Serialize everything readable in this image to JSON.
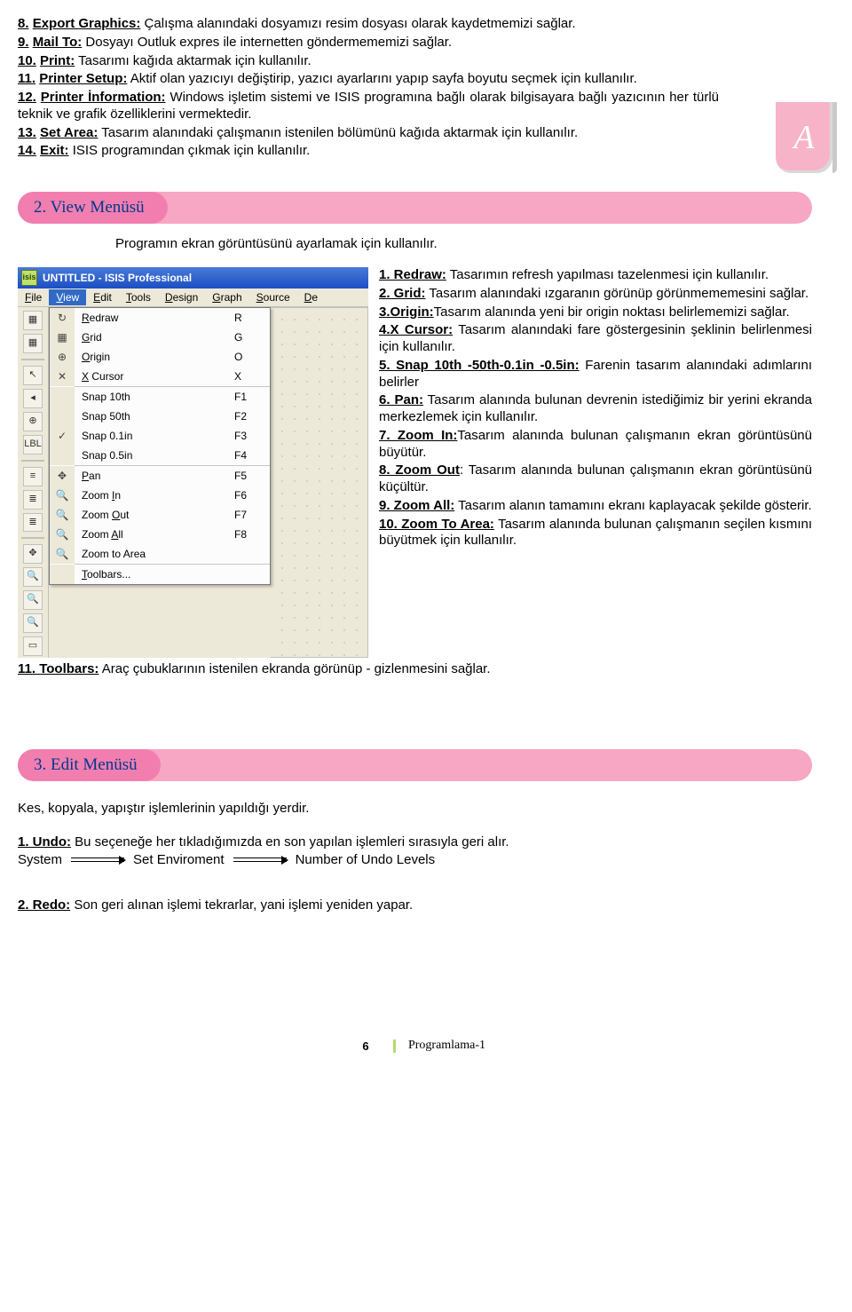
{
  "side_tab": "A",
  "pink1_label": "2. View Menüsü",
  "pink2_label": "3. Edit Menüsü",
  "top_items": [
    {
      "num": "8.",
      "title": "Export Graphics:",
      "text": " Çalışma alanındaki dosyamızı resim dosyası olarak kaydetmemizi sağlar."
    },
    {
      "num": "9.",
      "title": "Mail To:",
      "text": " Dosyayı  Outluk expres ile internetten göndermememizi sağlar."
    },
    {
      "num": "10.",
      "title": "Print:",
      "text": " Tasarımı kağıda aktarmak için kullanılır."
    },
    {
      "num": "11.",
      "title": "Printer Setup:",
      "text": " Aktif olan yazıcıyı değiştirip,  yazıcı ayarlarını yapıp sayfa boyutu seçmek için kullanılır."
    },
    {
      "num": "12.",
      "title": "Printer İnformation:",
      "text": " Windows işletim sistemi ve ISIS programına bağlı olarak bilgisayara bağlı yazıcının her türlü teknik ve grafik özelliklerini vermektedir."
    },
    {
      "num": "13.",
      "title": "Set Area:",
      "text": " Tasarım alanındaki çalışmanın istenilen bölümünü kağıda aktarmak için kullanılır."
    },
    {
      "num": "14.",
      "title": "Exit:",
      "text": "  ISIS programından çıkmak için kullanılır."
    }
  ],
  "view_intro": "Programın ekran görüntüsünü ayarlamak için kullanılır.",
  "titlebar": "UNTITLED - ISIS Professional",
  "menubar": [
    "File",
    "View",
    "Edit",
    "Tools",
    "Design",
    "Graph",
    "Source",
    "De"
  ],
  "menubar_active_index": 1,
  "menu_items": [
    {
      "icon": "↻",
      "label": "Redraw",
      "ul": "R",
      "key": "R"
    },
    {
      "icon": "▦",
      "label": "Grid",
      "ul": "G",
      "key": "G"
    },
    {
      "icon": "⊕",
      "label": "Origin",
      "ul": "O",
      "key": "O"
    },
    {
      "icon": "✕",
      "label": "X Cursor",
      "ul": "X",
      "key": "X"
    },
    {
      "sep": true
    },
    {
      "icon": "",
      "label": "Snap 10th",
      "key": "F1"
    },
    {
      "icon": "",
      "label": "Snap 50th",
      "key": "F2"
    },
    {
      "icon": "✓",
      "label": "Snap 0.1in",
      "key": "F3"
    },
    {
      "icon": "",
      "label": "Snap 0.5in",
      "key": "F4"
    },
    {
      "sep": true
    },
    {
      "icon": "✥",
      "label": "Pan",
      "ul": "P",
      "key": "F5"
    },
    {
      "icon": "🔍",
      "label": "Zoom In",
      "ul": "I",
      "key": "F6"
    },
    {
      "icon": "🔍",
      "label": "Zoom Out",
      "ul": "O",
      "key": "F7"
    },
    {
      "icon": "🔍",
      "label": "Zoom All",
      "ul": "A",
      "key": "F8"
    },
    {
      "icon": "🔍",
      "label": "Zoom to Area",
      "key": ""
    },
    {
      "sep": true
    },
    {
      "icon": "",
      "label": "Toolbars...",
      "ul": "T",
      "key": ""
    }
  ],
  "left_tools": [
    "▦",
    "▦",
    "↖",
    "◂",
    "⊕",
    "LBL",
    "≡",
    "≣",
    "≣",
    "✥",
    "🔍",
    "🔍",
    "🔍",
    "▭"
  ],
  "right_items": [
    {
      "title": "1. Redraw:",
      "text": " Tasarımın refresh yapılması tazelenmesi için kullanılır."
    },
    {
      "title": "2. Grid:",
      "text": " Tasarım alanındaki ızgaranın görünüp görünmememesini sağlar."
    },
    {
      "title": "3.Origin:",
      "text": "Tasarım alanında yeni bir origin noktası belirlememizi sağlar."
    },
    {
      "title": "4.X Cursor:",
      "text": " Tasarım alanındaki fare göstergesinin şeklinin belirlenmesi için kullanılır."
    },
    {
      "title": "5. Snap 10th -50th-0.1in -0.5in:",
      "text": " Farenin tasarım alanındaki adımlarını belirler"
    },
    {
      "title": "6. Pan:",
      "text": " Tasarım alanında bulunan devrenin istediğimiz bir yerini ekranda merkezlemek için kullanılır."
    },
    {
      "title": "7. Zoom In:",
      "text": "Tasarım alanında bulunan çalışmanın ekran görüntüsünü büyütür."
    },
    {
      "title": "8. Zoom Out",
      "text": ": Tasarım alanında bulunan çalışmanın ekran görüntüsünü küçültür."
    },
    {
      "title": "9. Zoom All:",
      "text": " Tasarım alanın tamamını ekranı kaplayacak şekilde gösterir."
    },
    {
      "title": "10. Zoom To Area:",
      "text": " Tasarım alanında bulunan çalışmanın seçilen kısmını büyütmek için kullanılır."
    }
  ],
  "toolbars_line": {
    "title": "11. Toolbars:",
    "text": " Araç çubuklarının istenilen ekranda görünüp - gizlenmesini sağlar."
  },
  "edit_intro": "Kes, kopyala, yapıştır işlemlerinin yapıldığı yerdir.",
  "edit_undo": {
    "title": "1. Undo:",
    "text": " Bu seçeneğe her tıkladığımızda en son yapılan işlemleri sırasıyla geri alır."
  },
  "undo_chain": [
    "System",
    "Set Enviroment",
    "Number of Undo Levels"
  ],
  "edit_redo": {
    "title": "2. Redo:",
    "text": " Son geri alınan işlemi tekrarlar, yani işlemi yeniden yapar."
  },
  "footer": {
    "page": "6",
    "text": "Programlama-1"
  }
}
